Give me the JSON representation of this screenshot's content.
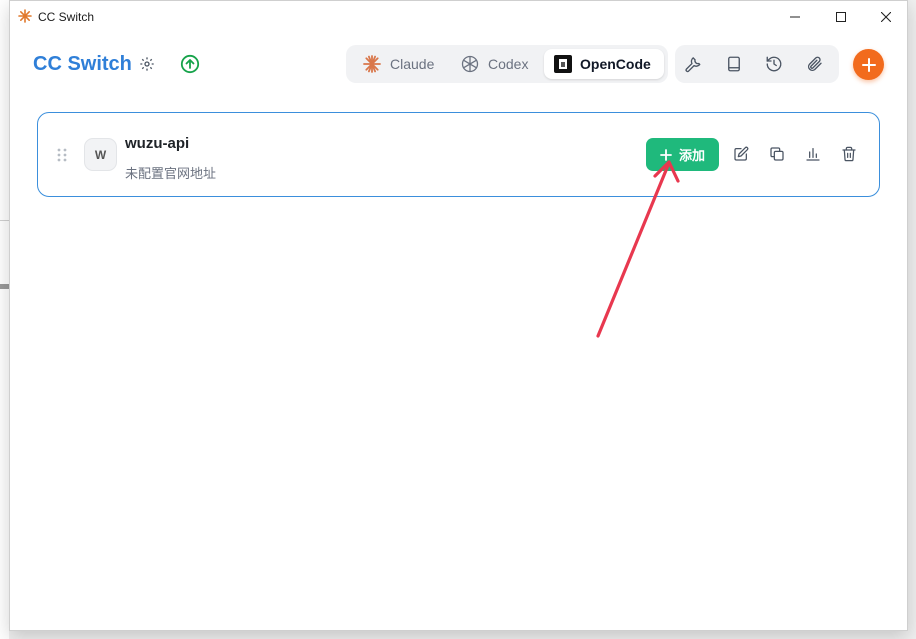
{
  "window": {
    "title": "CC Switch"
  },
  "header": {
    "brand": "CC Switch",
    "apps": [
      {
        "label": "Claude",
        "active": false
      },
      {
        "label": "Codex",
        "active": false
      },
      {
        "label": "OpenCode",
        "active": true
      }
    ],
    "tools": [
      "wrench-icon",
      "book-icon",
      "history-icon",
      "paperclip-icon"
    ],
    "accent": "#2f7fd8",
    "fab_color": "#f26b1d"
  },
  "provider": {
    "avatar_letter": "W",
    "name": "wuzu-api",
    "subtitle": "未配置官网地址",
    "add_label": "添加",
    "add_color": "#1fb97c"
  },
  "annotation": {
    "arrow_color": "#e8384f"
  }
}
